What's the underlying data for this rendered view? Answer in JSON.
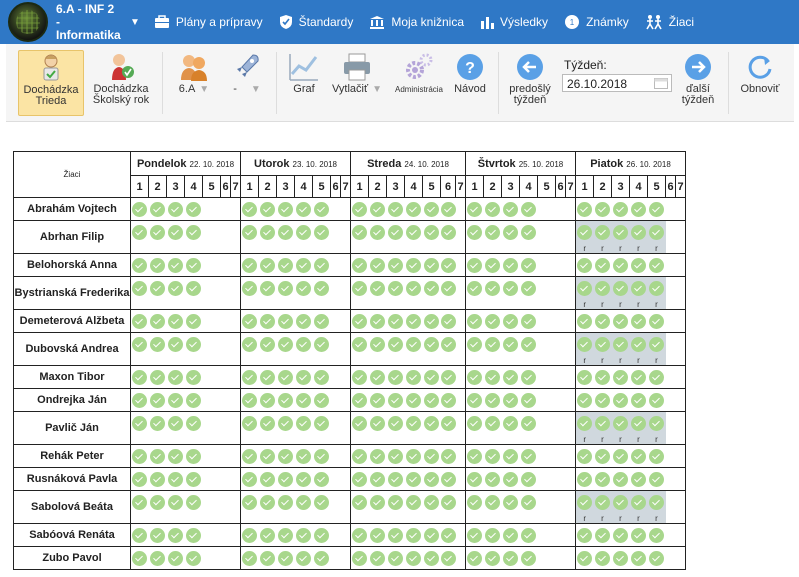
{
  "topbar": {
    "class_line1": "6.A - INF 2",
    "class_line2": "- Informatika",
    "nav": [
      {
        "label": "Plány a prípravy",
        "icon": "briefcase-icon"
      },
      {
        "label": "Štandardy",
        "icon": "shield-check-icon"
      },
      {
        "label": "Moja knižnica",
        "icon": "library-icon"
      },
      {
        "label": "Výsledky",
        "icon": "bar-chart-icon"
      },
      {
        "label": "Známky",
        "icon": "grade-badge-icon"
      },
      {
        "label": "Žiaci",
        "icon": "students-icon"
      }
    ]
  },
  "toolbar": {
    "attendance_class": "Dochádzka\nTrieda",
    "attendance_year": "Dochádzka\nŠkolský rok",
    "class_dropdown": "6.A",
    "group_dropdown": "-",
    "chart": "Graf",
    "print": "Vytlačiť",
    "admin": "Administrácia",
    "help": "Návod",
    "prev_week": "predošlý\ntýždeň",
    "week_label": "Týždeň:",
    "week_value": "26.10.2018",
    "next_week": "ďalší\ntýždeň",
    "refresh": "Obnoviť"
  },
  "grid": {
    "students_header": "Žiaci",
    "days": [
      {
        "name": "Pondelok",
        "date": "22. 10. 2018"
      },
      {
        "name": "Utorok",
        "date": "23. 10. 2018"
      },
      {
        "name": "Streda",
        "date": "24. 10. 2018"
      },
      {
        "name": "Štvrtok",
        "date": "25. 10. 2018"
      },
      {
        "name": "Piatok",
        "date": "26. 10. 2018"
      }
    ],
    "lesson_numbers": [
      "1",
      "2",
      "3",
      "4",
      "5",
      "6",
      "7"
    ],
    "day_lessons": [
      4,
      5,
      6,
      4,
      5
    ],
    "r_mark": "r",
    "students": [
      {
        "name": "Abrahám Vojtech",
        "friday_r": false
      },
      {
        "name": "Abrhan Filip",
        "friday_r": true
      },
      {
        "name": "Belohorská Anna",
        "friday_r": false
      },
      {
        "name": "Bystrianská Frederika",
        "friday_r": true
      },
      {
        "name": "Demeterová Alžbeta",
        "friday_r": false
      },
      {
        "name": "Dubovská Andrea",
        "friday_r": true
      },
      {
        "name": "Maxon Tibor",
        "friday_r": false
      },
      {
        "name": "Ondrejka Ján",
        "friday_r": false
      },
      {
        "name": "Pavlič Ján",
        "friday_r": true
      },
      {
        "name": "Rehák Peter",
        "friday_r": false
      },
      {
        "name": "Rusnáková Pavla",
        "friday_r": false
      },
      {
        "name": "Sabolová Beáta",
        "friday_r": true
      },
      {
        "name": "Sabóová Renáta",
        "friday_r": false
      },
      {
        "name": "Zubo Pavol",
        "friday_r": false
      }
    ]
  },
  "colors": {
    "topbar": "#2f78c6",
    "check": "#a8d78c",
    "active_tool": "#fbe4a4",
    "r_cell": "#d0d8de"
  }
}
